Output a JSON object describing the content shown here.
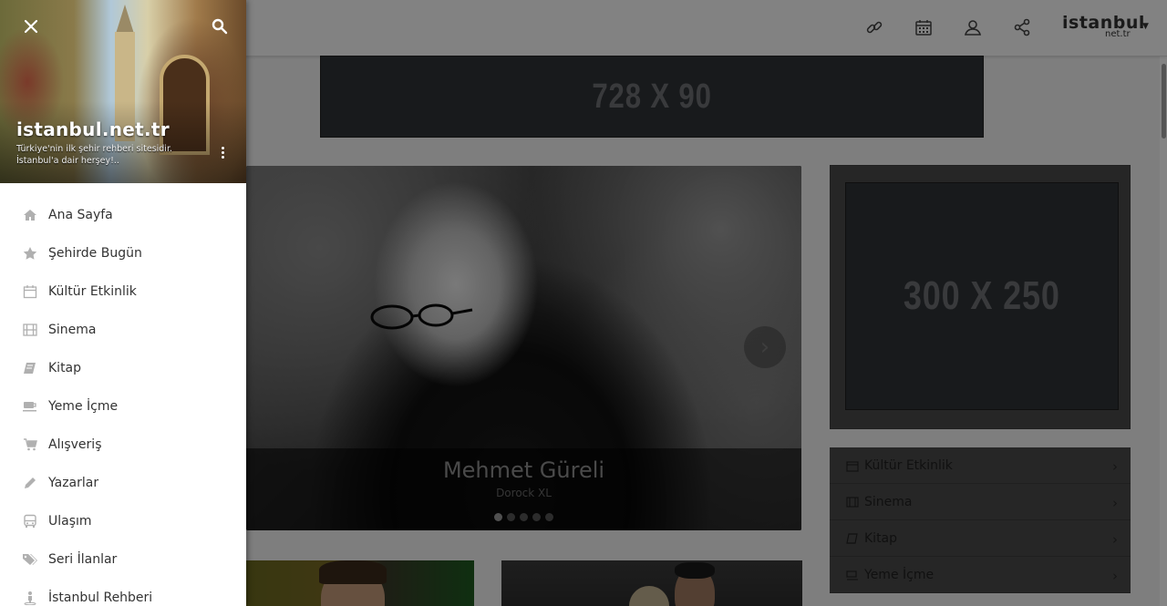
{
  "header": {
    "brand_main": "istanbul",
    "brand_sub": "net.tr",
    "icons": [
      "link-icon",
      "calendar-icon",
      "user-icon",
      "share-icon"
    ]
  },
  "ads": {
    "top_banner": "728 X 90",
    "side_box": "300 X 250"
  },
  "slider": {
    "title": "Mehmet Güreli",
    "subtitle": "Dorock XL",
    "slide_count": 5,
    "active_slide": 1
  },
  "side_categories": [
    {
      "label": "Kültür Etkinlik",
      "icon": "calendar-icon"
    },
    {
      "label": "Sinema",
      "icon": "film-icon"
    },
    {
      "label": "Kitap",
      "icon": "book-icon"
    },
    {
      "label": "Yeme İçme",
      "icon": "cup-icon"
    }
  ],
  "drawer": {
    "title": "istanbul.net.tr",
    "subtitle": "Türkiye'nin ilk şehir rehberi sitesidir. İstanbul'a dair herşey!..",
    "items": [
      {
        "label": "Ana Sayfa",
        "icon": "home-icon"
      },
      {
        "label": "Şehirde Bugün",
        "icon": "star-icon"
      },
      {
        "label": "Kültür Etkinlik",
        "icon": "calendar-icon"
      },
      {
        "label": "Sinema",
        "icon": "film-icon"
      },
      {
        "label": "Kitap",
        "icon": "book-icon"
      },
      {
        "label": "Yeme İçme",
        "icon": "cup-icon"
      },
      {
        "label": "Alışveriş",
        "icon": "cart-icon"
      },
      {
        "label": "Yazarlar",
        "icon": "pencil-icon"
      },
      {
        "label": "Ulaşım",
        "icon": "bus-icon"
      },
      {
        "label": "Seri İlanlar",
        "icon": "tags-icon"
      },
      {
        "label": "İstanbul Rehberi",
        "icon": "person-pin-icon"
      }
    ]
  },
  "colors": {
    "overlay": "#000000",
    "drawer_bg": "#ffffff",
    "menu_text": "#333333",
    "menu_icon": "#b0b0b0"
  }
}
